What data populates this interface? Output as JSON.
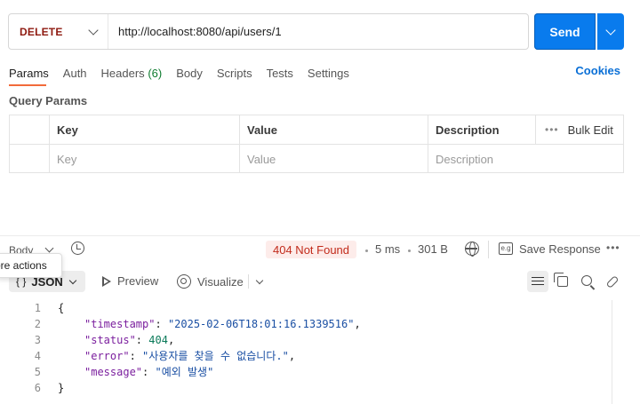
{
  "request": {
    "method": "DELETE",
    "url": "http://localhost:8080/api/users/1",
    "send_label": "Send"
  },
  "tabs": [
    {
      "label": "Params",
      "active": true
    },
    {
      "label": "Auth"
    },
    {
      "label": "Headers",
      "count": "(6)"
    },
    {
      "label": "Body"
    },
    {
      "label": "Scripts"
    },
    {
      "label": "Tests"
    },
    {
      "label": "Settings"
    }
  ],
  "cookies_label": "Cookies",
  "query_params": {
    "title": "Query Params",
    "headers": {
      "key": "Key",
      "value": "Value",
      "description": "Description",
      "bulk_edit": "Bulk Edit"
    },
    "placeholders": {
      "key": "Key",
      "value": "Value",
      "description": "Description"
    }
  },
  "response": {
    "body_label": "Body",
    "tooltip": "ore actions",
    "status": "404 Not Found",
    "time": "5 ms",
    "size": "301 B",
    "save_label": "Save Response",
    "format": "JSON",
    "preview_label": "Preview",
    "visualize_label": "Visualize",
    "lines": [
      {
        "num": "1",
        "text": "{"
      },
      {
        "num": "2",
        "key": "\"timestamp\"",
        "value": "\"2025-02-06T18:01:16.1339516\"",
        "type": "s",
        "trail": ","
      },
      {
        "num": "3",
        "key": "\"status\"",
        "value": "404",
        "type": "n",
        "trail": ","
      },
      {
        "num": "4",
        "key": "\"error\"",
        "value": "\"사용자를 찾을 수 없습니다.\"",
        "type": "s",
        "trail": ","
      },
      {
        "num": "5",
        "key": "\"message\"",
        "value": "\"예외 발생\"",
        "type": "s",
        "trail": ""
      },
      {
        "num": "6",
        "text": "}"
      }
    ]
  },
  "colors": {
    "accent": "#097bed",
    "active_tab": "#f26b3a",
    "error": "#c22b1b",
    "method": "#8e1a10"
  }
}
